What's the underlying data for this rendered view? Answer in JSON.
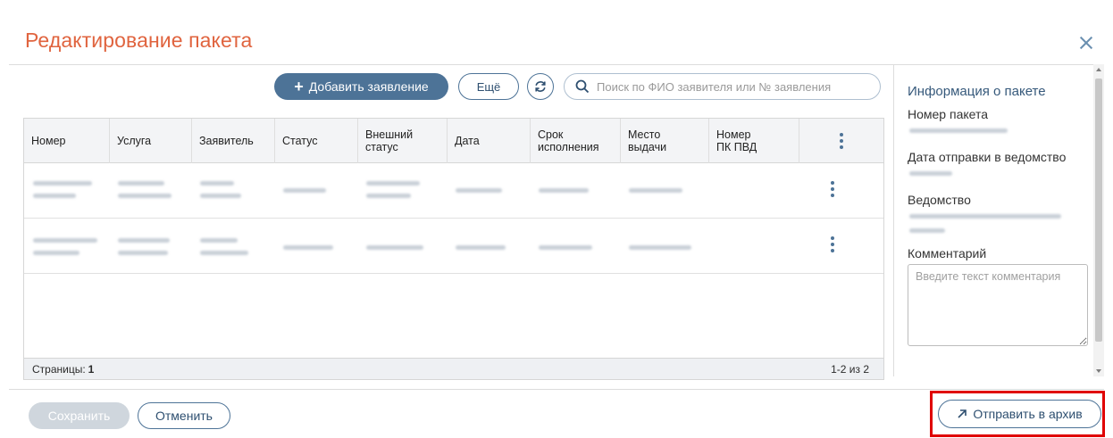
{
  "dialog": {
    "title": "Редактирование пакета"
  },
  "toolbar": {
    "add_label": "Добавить заявление",
    "more_label": "Ещё",
    "search_placeholder": "Поиск по ФИО заявителя или № заявления"
  },
  "table": {
    "columns": [
      "Номер",
      "Услуга",
      "Заявитель",
      "Статус",
      "Внешний статус",
      "Дата",
      "Срок исполнения",
      "Место выдачи",
      "Номер ПК ПВД"
    ],
    "rows_count_visible": 2,
    "pages_label": "Страницы:",
    "pages_value": "1",
    "range_label": "1-2 из 2"
  },
  "side_panel": {
    "title": "Информация о пакете",
    "package_number_label": "Номер пакета",
    "sent_date_label": "Дата отправки в ведомство",
    "department_label": "Ведомство",
    "comment_label": "Комментарий",
    "comment_placeholder": "Введите текст комментария"
  },
  "footer": {
    "save_label": "Сохранить",
    "cancel_label": "Отменить",
    "archive_label": "Отправить в архив"
  },
  "colors": {
    "title": "#e0643f",
    "primary": "#4d7397",
    "highlight": "#e00000"
  }
}
